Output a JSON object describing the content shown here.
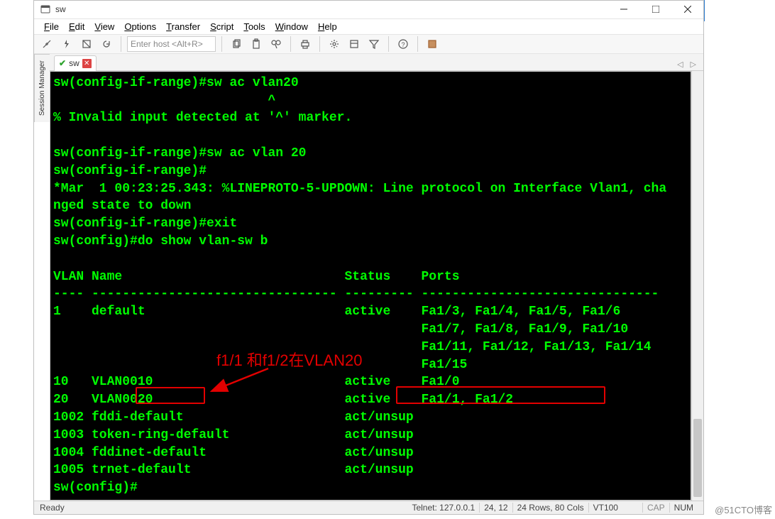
{
  "titlebar": {
    "title": "sw"
  },
  "menu": {
    "items": [
      {
        "u": "F",
        "rest": "ile"
      },
      {
        "u": "E",
        "rest": "dit"
      },
      {
        "u": "V",
        "rest": "iew"
      },
      {
        "u": "O",
        "rest": "ptions"
      },
      {
        "u": "T",
        "rest": "ransfer"
      },
      {
        "u": "S",
        "rest": "cript"
      },
      {
        "u": "T",
        "rest": "ools"
      },
      {
        "u": "W",
        "rest": "indow"
      },
      {
        "u": "H",
        "rest": "elp"
      }
    ]
  },
  "toolbar": {
    "host_placeholder": "Enter host <Alt+R>"
  },
  "tab": {
    "label": "sw"
  },
  "session_manager_label": "Session Manager",
  "terminal": {
    "lines": [
      "sw(config-if-range)#sw ac vlan20",
      "                            ^",
      "% Invalid input detected at '^' marker.",
      "",
      "sw(config-if-range)#sw ac vlan 20",
      "sw(config-if-range)#",
      "*Mar  1 00:23:25.343: %LINEPROTO-5-UPDOWN: Line protocol on Interface Vlan1, cha",
      "nged state to down",
      "sw(config-if-range)#exit",
      "sw(config)#do show vlan-sw b",
      "",
      "VLAN Name                             Status    Ports",
      "---- -------------------------------- --------- -------------------------------",
      "1    default                          active    Fa1/3, Fa1/4, Fa1/5, Fa1/6",
      "                                                Fa1/7, Fa1/8, Fa1/9, Fa1/10",
      "                                                Fa1/11, Fa1/12, Fa1/13, Fa1/14",
      "                                                Fa1/15",
      "10   VLAN0010                         active    Fa1/0",
      "20   VLAN0020                         active    Fa1/1, Fa1/2",
      "1002 fddi-default                     act/unsup",
      "1003 token-ring-default               act/unsup",
      "1004 fddinet-default                  act/unsup",
      "1005 trnet-default                    act/unsup",
      "sw(config)#"
    ]
  },
  "annotation": {
    "text": "f1/1 和f1/2在VLAN20"
  },
  "status": {
    "ready": "Ready",
    "conn": "Telnet: 127.0.0.1",
    "pos": "24,  12",
    "size": "24 Rows, 80 Cols",
    "emu": "VT100",
    "cap": "CAP",
    "num": "NUM"
  },
  "watermark": "@51CTO博客"
}
